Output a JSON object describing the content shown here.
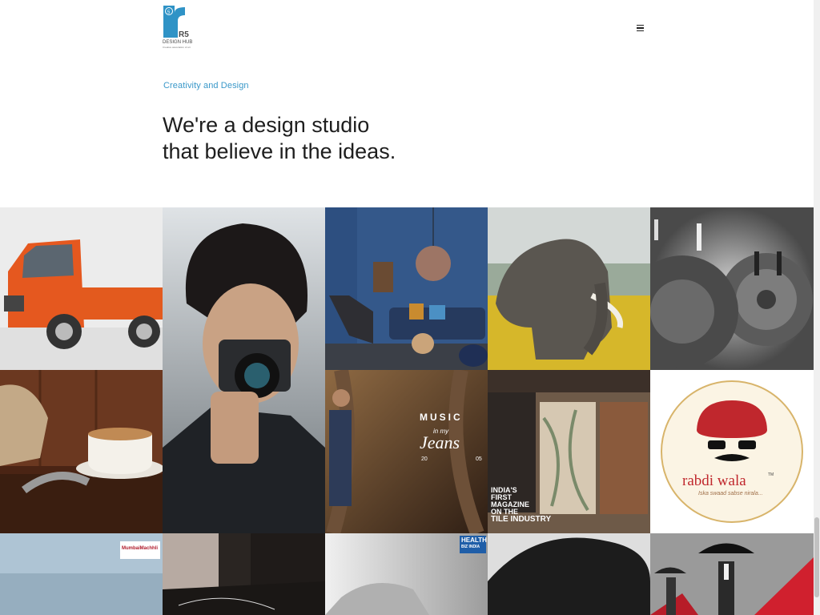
{
  "brand": {
    "mark": "R5",
    "name": "DESIGN HUB",
    "sub": "Creative association of art"
  },
  "hero": {
    "tagline": "Creativity and Design",
    "headline_line1": "We're a design studio",
    "headline_line2": "that believe in the ideas."
  },
  "portfolio": {
    "music_title": "MUSIC",
    "music_in": "in my",
    "music_jeans": "Jeans",
    "music_year_left": "20",
    "music_year_right": "05",
    "tile_mag_line1": "INDIA'S",
    "tile_mag_line2": "FIRST",
    "tile_mag_line3": "MAGAZINE",
    "tile_mag_line4": "ON THE",
    "tile_mag_line5": "TILE INDUSTRY",
    "rabdi_name": "rabdi wala",
    "rabdi_tm": "TM",
    "rabdi_slogan": "Iska swaad sabse nirala...",
    "mumbai_label": "MumbaiMachhli",
    "health_line1": "HEALTH",
    "health_line2": "BIZ INDIA"
  },
  "colors": {
    "accent": "#3a98c9",
    "rabdi_red": "#c0272d"
  },
  "icons": {
    "menu": "hamburger-menu-icon"
  }
}
